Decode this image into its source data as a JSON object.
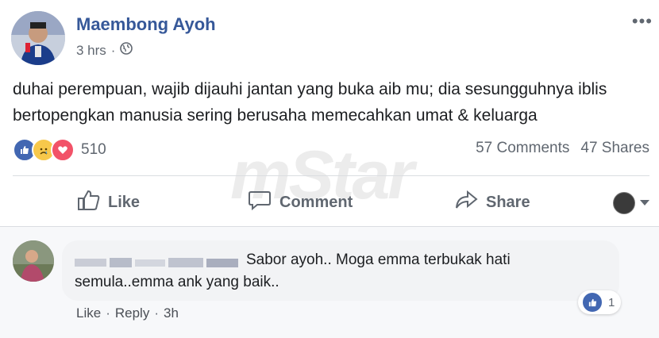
{
  "post": {
    "author": "Maembong Ayoh",
    "time": "3 hrs",
    "privacy_icon": "globe-icon",
    "more_icon": "ellipsis-icon",
    "text": "duhai perempuan, wajib dijauhi jantan yang buka aib mu; dia sesungguhnya iblis bertopengkan manusia sering berusaha memecahkan umat & keluarga",
    "reaction_icons": [
      "like-icon",
      "sad-icon",
      "love-icon"
    ],
    "reaction_count": "510",
    "comments_count": "57 Comments",
    "shares_count": "47 Shares"
  },
  "actions": {
    "like": "Like",
    "comment": "Comment",
    "share": "Share"
  },
  "watermark": "mStar",
  "comment": {
    "text": "Sabor ayoh.. Moga emma terbukak hati semula..emma ank yang baik..",
    "reaction_count": "1",
    "like": "Like",
    "reply": "Reply",
    "time": "3h"
  },
  "colors": {
    "brand": "#365899",
    "like_blue": "#4267b2",
    "love_red": "#f25268",
    "sad_yellow": "#f7c84b"
  }
}
